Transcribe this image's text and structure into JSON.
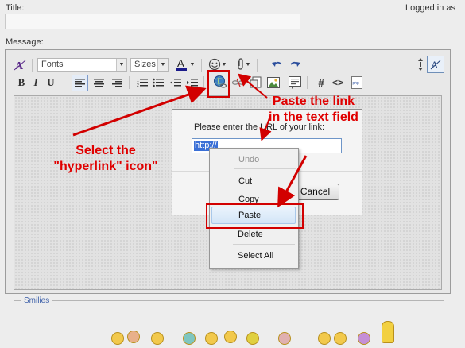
{
  "form": {
    "title_label": "Title:",
    "logged_in_text": "Logged in as",
    "message_label": "Message:"
  },
  "toolbar": {
    "font_select": "Fonts",
    "size_select": "Sizes",
    "buttons": [
      "bold",
      "italic",
      "underline",
      "align-left",
      "align-center",
      "align-right",
      "ordered-list",
      "unordered-list",
      "outdent",
      "indent",
      "hyperlink",
      "unlink",
      "insert-image-file",
      "insert-image",
      "quote",
      "code",
      "html-source",
      "php"
    ]
  },
  "dialog": {
    "prompt": "Please enter the URL of your link:",
    "url_value": "http://",
    "cancel_label": "Cancel"
  },
  "context_menu": {
    "items": [
      {
        "label": "Undo",
        "enabled": false
      },
      {
        "label": "Cut",
        "enabled": true
      },
      {
        "label": "Copy",
        "enabled": true
      },
      {
        "label": "Paste",
        "enabled": true,
        "highlighted": true
      },
      {
        "label": "Delete",
        "enabled": true
      },
      {
        "label": "Select All",
        "enabled": true
      }
    ]
  },
  "annotations": {
    "select_hyperlink_line1": "Select the",
    "select_hyperlink_line2": "\"hyperlink\" icon\"",
    "paste_link_line1": "Paste the link",
    "paste_link_line2": "in the text field",
    "color": "#e00000"
  },
  "smilies": {
    "label": "Smilies"
  },
  "colors": {
    "accent_red": "#d20000",
    "selection_blue": "#3a6fd6",
    "highlight_blue": "#d3e5f7"
  }
}
